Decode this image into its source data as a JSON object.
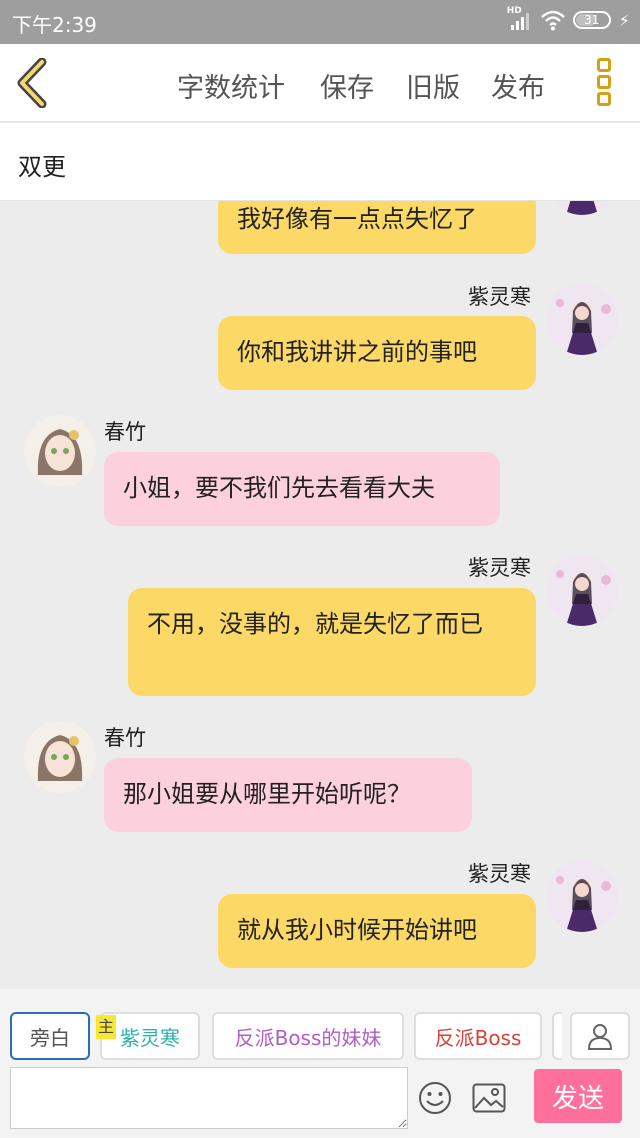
{
  "status_bar": {
    "time": "下午2:39",
    "network": "HD",
    "battery": "31"
  },
  "toolbar": {
    "back_icon": "chevron-left-icon",
    "word_count": "字数统计",
    "save": "保存",
    "old_version": "旧版",
    "publish": "发布",
    "more_icon": "three-dots-icon"
  },
  "chapter_title": "双更",
  "messages": [
    {
      "side": "right",
      "speaker": "",
      "text": "我好像有一点点失忆了"
    },
    {
      "side": "right",
      "speaker": "紫灵寒",
      "text": "你和我讲讲之前的事吧"
    },
    {
      "side": "left",
      "speaker": "春竹",
      "text": "小姐，要不我们先去看看大夫"
    },
    {
      "side": "right",
      "speaker": "紫灵寒",
      "text": "不用，没事的，就是失忆了而已"
    },
    {
      "side": "left",
      "speaker": "春竹",
      "text": "那小姐要从哪里开始听呢？"
    },
    {
      "side": "right",
      "speaker": "紫灵寒",
      "text": "就从我小时候开始讲吧"
    }
  ],
  "roles": {
    "narration": "旁白",
    "owner_tag": "主",
    "role1": "紫灵寒",
    "role2": "反派Boss的妹妹",
    "role3": "反派Boss",
    "role_colors": {
      "role1": "#2bb3a8",
      "role2": "#b05ec9",
      "role3": "#d9413a"
    }
  },
  "input": {
    "placeholder": "",
    "send_label": "发送"
  },
  "colors": {
    "my_bubble": "#fcd966",
    "other_bubble": "#fdd0de",
    "send": "#ff6f9c",
    "accent": "#d4a017"
  }
}
